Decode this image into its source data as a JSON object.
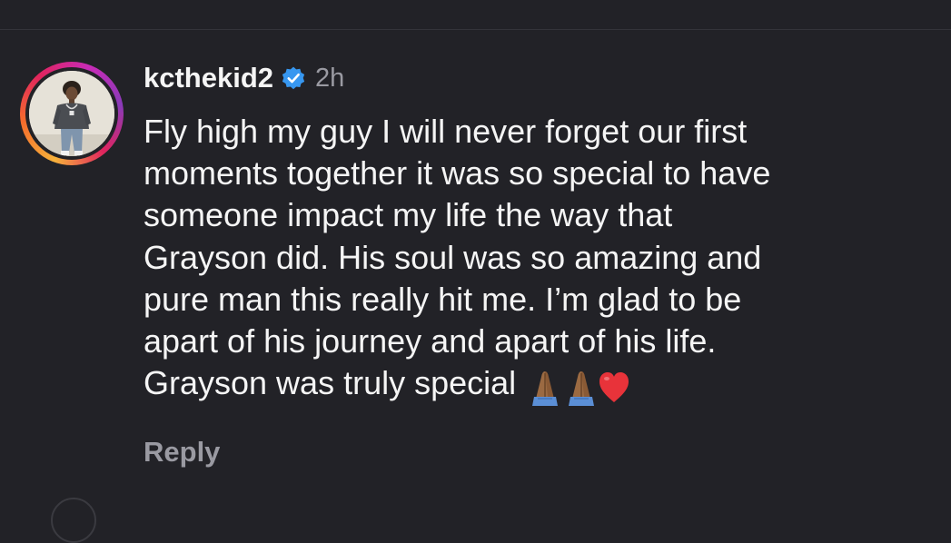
{
  "comment": {
    "username": "kcthekid2",
    "verified": true,
    "timestamp": "2h",
    "text_lines": [
      "Fly high my guy I will never forget our first",
      "moments together it was so special to have",
      "someone impact my life the way that",
      "Grayson did. His soul was so amazing and",
      "pure man this really hit me. I’m glad to be",
      "apart of his journey and apart of his life.",
      "Grayson was truly special"
    ],
    "emojis": [
      "folded-hands-medium-dark-skin",
      "folded-hands-medium-dark-skin",
      "red-heart"
    ],
    "reply_label": "Reply"
  },
  "colors": {
    "background": "#222227",
    "primary_text": "#f5f5f5",
    "secondary_text": "#9a9aa2",
    "verified_badge": "#3797f0"
  }
}
